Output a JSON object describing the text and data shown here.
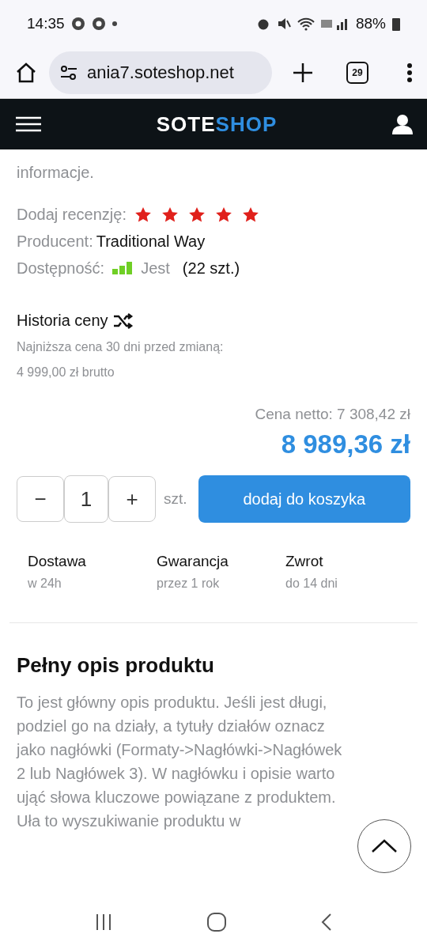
{
  "status_bar": {
    "time": "14:35",
    "battery": "88%"
  },
  "browser": {
    "url": "ania7.soteshop.net",
    "tab_count": "29"
  },
  "header": {
    "logo_left": "SOTE",
    "logo_right": "SHOP"
  },
  "intro": {
    "text": "informacje."
  },
  "review": {
    "label": "Dodaj recenzję:",
    "stars": 5
  },
  "producer": {
    "label": "Producent:",
    "value": "Traditional Way"
  },
  "availability": {
    "label": "Dostępność:",
    "value": "Jest",
    "count": "(22 szt.)"
  },
  "price_history": {
    "title": "Historia ceny",
    "note": "Najniższa cena 30 dni przed zmianą:",
    "lowest": "4 999,00 zł brutto"
  },
  "price": {
    "net": "Cena netto: 7 308,42 zł",
    "gross": "8 989,36 zł"
  },
  "quantity": {
    "minus": "−",
    "value": "1",
    "plus": "+",
    "unit": "szt."
  },
  "add_to_cart": "dodaj do koszyka",
  "features": [
    {
      "title": "Dostawa",
      "subtitle": "w 24h"
    },
    {
      "title": "Gwarancja",
      "subtitle": "przez 1 rok"
    },
    {
      "title": "Zwrot",
      "subtitle": "do 14 dni"
    }
  ],
  "description": {
    "title": "Pełny opis produktu",
    "text": "To jest główny opis produktu. Jeśli jest długi, podziel go na działy, a tytuły działów oznacz jako nagłówki (Formaty->Nagłówki->Nagłówek 2 lub Nagłówek 3). W nagłówku i opisie warto ująć słowa kluczowe powiązane z produktem. Uła to wyszukiwanie produktu w"
  }
}
